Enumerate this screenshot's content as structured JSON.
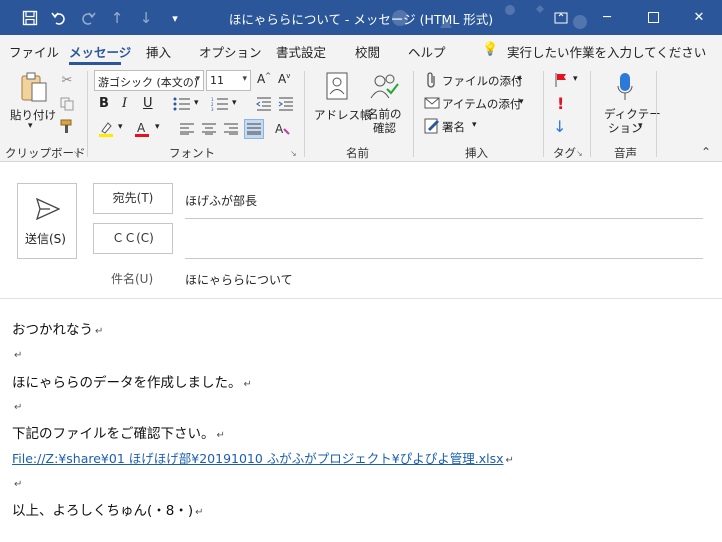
{
  "window": {
    "title": "ほにゃららについて  -  メッセージ (HTML 形式)",
    "accent_color": "#2b579a"
  },
  "menu": {
    "items": [
      "ファイル",
      "メッセージ",
      "挿入",
      "オプション",
      "書式設定",
      "校閲",
      "ヘルプ"
    ],
    "active": "メッセージ",
    "tell_me": "実行したい作業を入力してください"
  },
  "ribbon": {
    "clipboard": {
      "paste_label": "貼り付け",
      "group_label": "クリップボード"
    },
    "font": {
      "font_name": "游ゴシック (本文の)",
      "font_size": "11",
      "group_label": "フォント"
    },
    "names": {
      "address_book": "アドレス帳",
      "check_names_1": "名前の",
      "check_names_2": "確認",
      "group_label": "名前"
    },
    "insert": {
      "attach_file": "ファイルの添付",
      "attach_item": "アイテムの添付",
      "signature": "署名",
      "group_label": "挿入"
    },
    "tags": {
      "group_label": "タグ"
    },
    "voice": {
      "dictate_1": "ディクテー",
      "dictate_2": "ション",
      "group_label": "音声"
    }
  },
  "header": {
    "send_label": "送信(S)",
    "to_label": "宛先(T)",
    "to_value": "ほげふが部長",
    "cc_label": "ＣＣ(C)",
    "cc_value": "",
    "subject_label": "件名(U)",
    "subject_value": "ほにゃららについて"
  },
  "body": {
    "line1": "おつかれなう",
    "line2": "ほにゃららのデータを作成しました。",
    "line3": "下記のファイルをご確認下さい。",
    "link": "File://Z:¥share¥01 ほげほげ部¥20191010 ふがふがプロジェクト¥ぴよぴよ管理.xlsx",
    "line4": "以上、よろしくちゅん(・8・)",
    "paragraph_mark": "↵"
  }
}
